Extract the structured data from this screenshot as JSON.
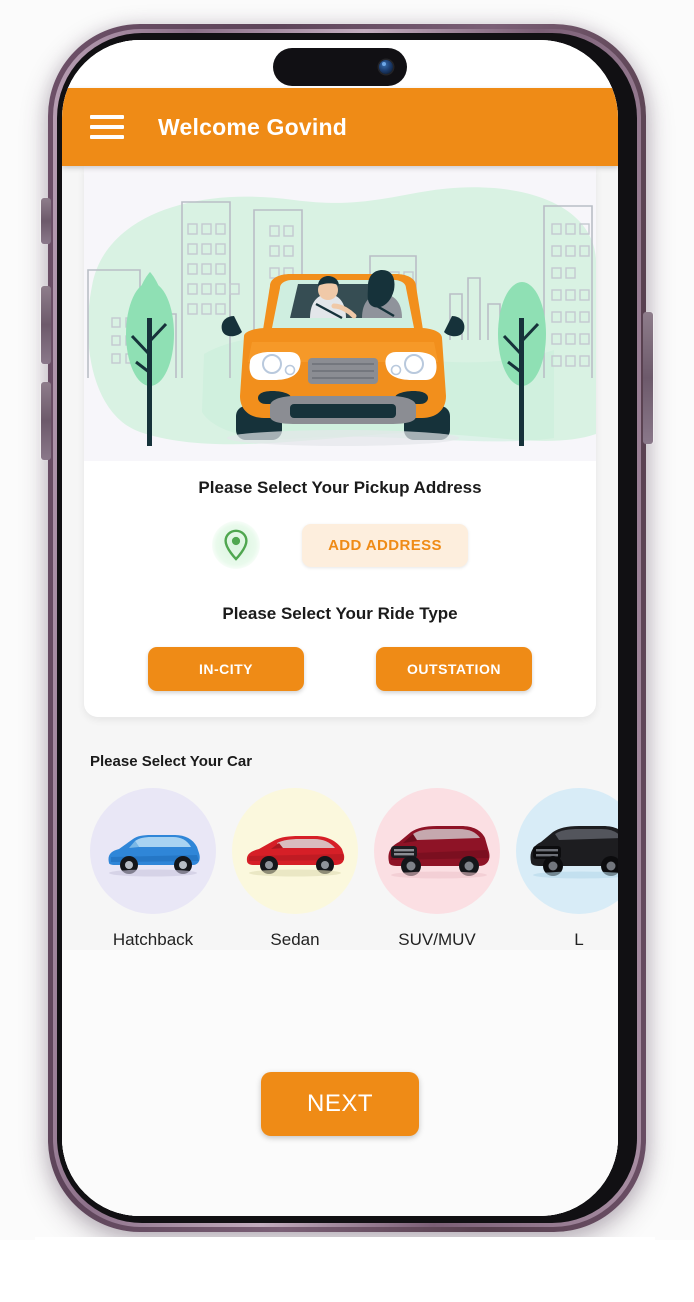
{
  "app": {
    "header": {
      "menu_icon": "hamburger-menu-icon",
      "title": "Welcome Govind"
    },
    "hero": {
      "alt": "illustration of a couple riding in an orange car through a city"
    },
    "pickup": {
      "title": "Please Select Your Pickup Address",
      "pin_icon": "location-pin-icon",
      "add_address_label": "ADD ADDRESS"
    },
    "ride_type": {
      "title": "Please Select Your Ride Type",
      "options": [
        {
          "label": "IN-CITY"
        },
        {
          "label": "OUTSTATION"
        }
      ]
    },
    "car_select": {
      "title": "Please Select Your Car",
      "cars": [
        {
          "label": "Hatchback",
          "circle_color": "#e9e7f6",
          "body_color": "#2f86d8"
        },
        {
          "label": "Sedan",
          "circle_color": "#fbf8dd",
          "body_color": "#d61f27"
        },
        {
          "label": "SUV/MUV",
          "circle_color": "#fbdfe3",
          "body_color": "#8e1326"
        },
        {
          "label": "L",
          "circle_color": "#d8ecf7",
          "body_color": "#1d1d20"
        }
      ]
    },
    "footer": {
      "next_label": "NEXT"
    },
    "colors": {
      "brand_orange": "#ef8b16",
      "add_address_bg": "#fdeedd",
      "pin_green": "#4fa64f",
      "screen_bg": "#f6f6f6",
      "card_bg": "#ffffff",
      "text_dark": "#1b1b1b"
    }
  },
  "device": {
    "frame_color": "#6d5068",
    "bezel_color": "#111013",
    "island_icon": "front-camera-icon"
  }
}
